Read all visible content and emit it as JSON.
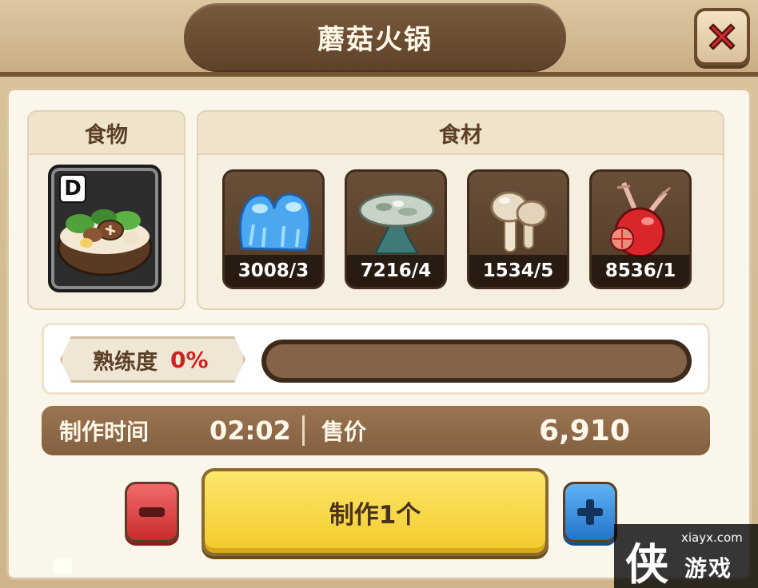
{
  "header": {
    "title": "蘑菇火锅"
  },
  "food": {
    "label": "食物",
    "grade": "D",
    "icon": "mushroom-hotpot-icon"
  },
  "ingredients": {
    "label": "食材",
    "items": [
      {
        "icon": "blue-jelly-icon",
        "count": "3008/3",
        "color": "#4aa7f0"
      },
      {
        "icon": "pale-mushroom-icon",
        "count": "7216/4",
        "color": "#b9c8bd"
      },
      {
        "icon": "brown-mushroom-icon",
        "count": "1534/5",
        "color": "#e8dcc8"
      },
      {
        "icon": "red-berry-icon",
        "count": "8536/1",
        "color": "#d9262a"
      }
    ]
  },
  "proficiency": {
    "label": "熟练度",
    "value_text": "0%",
    "value": 0
  },
  "info": {
    "time_label": "制作时间",
    "time": "02:02",
    "price_label": "售价",
    "price": "6,910"
  },
  "actions": {
    "make_label": "制作1个"
  },
  "watermark": {
    "char": "侠",
    "url": "xiayx.com",
    "name": "游戏"
  },
  "colors": {
    "accent": "#f2cb2a",
    "frame": "#6b4a2e",
    "danger": "#d02222"
  }
}
